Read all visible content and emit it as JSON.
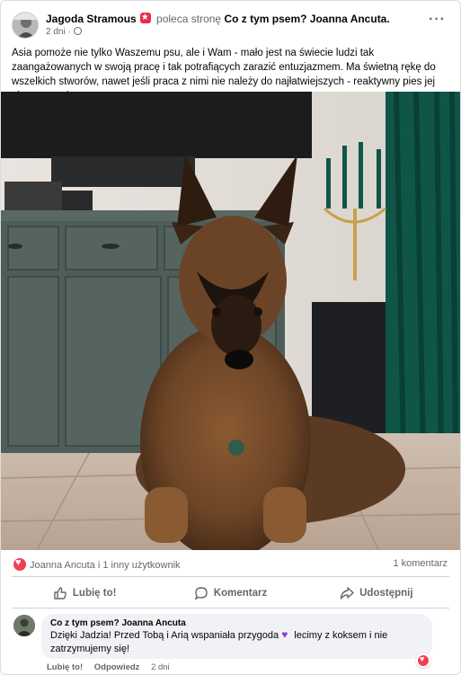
{
  "post": {
    "author": "Jagoda Stramous",
    "verb": "poleca stronę",
    "page": "Co z tym psem? Joanna Ancuta.",
    "time": "2 dni ·",
    "text": "Asia pomoże nie tylko Waszemu psu, ale i Wam - mało jest na świecie ludzi tak zaangażowanych w swoją pracę i tak potrafiących zarazić entuzjazmem. Ma świetną rękę do wszelkich stworów, nawet jeśli praca z nimi nie należy do najłatwiejszych - reaktywny pies jej niestraszny:)"
  },
  "reactions": {
    "summary": "Joanna Ancuta i 1 inny użytkownik",
    "comments": "1 komentarz"
  },
  "actions": {
    "like": "Lubię to!",
    "comment": "Komentarz",
    "share": "Udostępnij"
  },
  "comment": {
    "author": "Co z tym psem? Joanna Ancuta",
    "text_part1": "Dzięki Jadzia! Przed Tobą i Arią wspaniała przygoda",
    "text_part2": "lecimy z koksem i nie zatrzymujemy się!",
    "like": "Lubię to!",
    "reply": "Odpowiedz",
    "time": "2 dni"
  },
  "colors": {
    "accent_red": "#f33e58",
    "muted_text": "#65676b",
    "bubble_bg": "#f0f2f5"
  }
}
